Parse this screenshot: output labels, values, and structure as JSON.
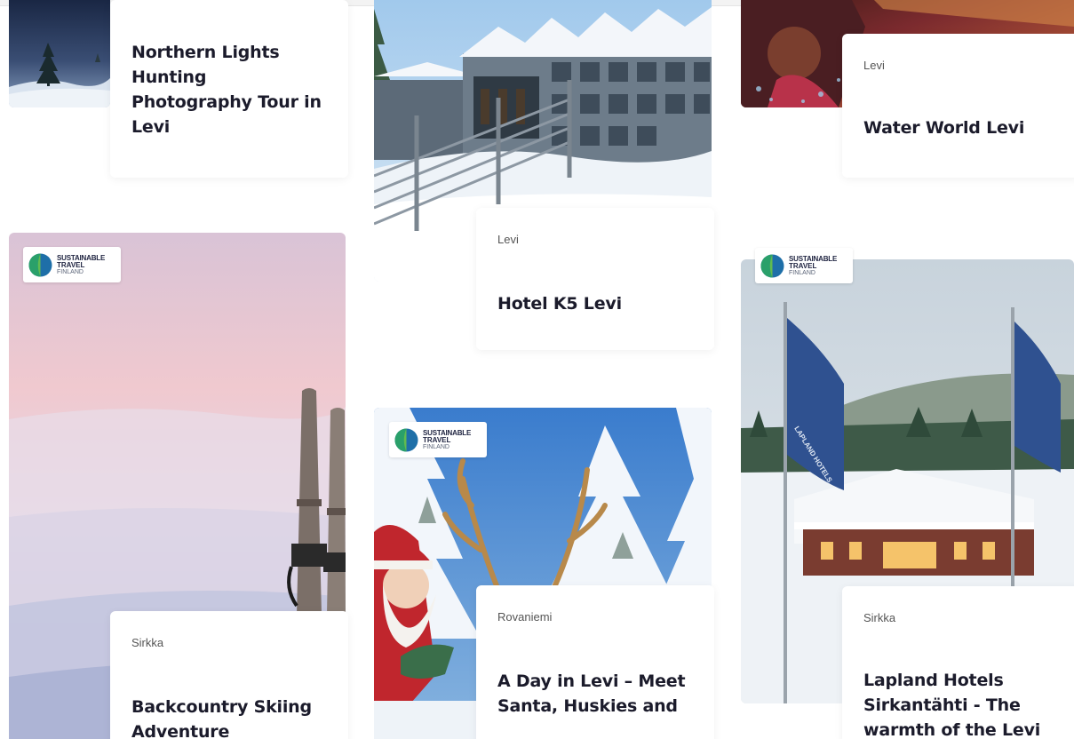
{
  "badge": {
    "line1": "SUSTAINABLE",
    "line2": "TRAVEL",
    "line3": "FINLAND"
  },
  "cards": [
    {
      "id": "northern-lights",
      "location": "",
      "title": "Northern Lights Hunting Photography Tour in Levi"
    },
    {
      "id": "hotel-k5",
      "location": "Levi",
      "title": "Hotel K5 Levi"
    },
    {
      "id": "water-world",
      "location": "Levi",
      "title": "Water World Levi"
    },
    {
      "id": "backcountry",
      "location": "Sirkka",
      "title": "Backcountry Skiing Adventure",
      "badge": true
    },
    {
      "id": "day-in-levi",
      "location": "Rovaniemi",
      "title": "A Day in Levi – Meet Santa, Huskies and",
      "badge": true
    },
    {
      "id": "lapland-hotels",
      "location": "Sirkka",
      "title": "Lapland Hotels Sirkantähti - The warmth of the Levi",
      "badge": true
    }
  ],
  "flag_text": "LAPLAND HOTELS",
  "colors": {
    "title": "#1b1b2b",
    "location": "#555555",
    "badge_green": "#2aa06a",
    "badge_blue": "#1e6fa8"
  }
}
